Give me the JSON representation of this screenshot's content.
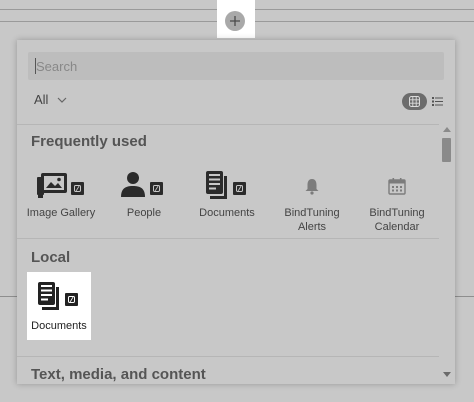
{
  "search": {
    "placeholder": "Search"
  },
  "filter": {
    "label": "All"
  },
  "sections": {
    "frequent": {
      "title": "Frequently used",
      "items": [
        {
          "label": "Image Gallery",
          "icon": "image-gallery-icon"
        },
        {
          "label": "People",
          "icon": "people-icon"
        },
        {
          "label": "Documents",
          "icon": "documents-icon"
        },
        {
          "label": "BindTuning Alerts",
          "icon": "bell-icon"
        },
        {
          "label": "BindTuning Calendar",
          "icon": "calendar-icon"
        }
      ]
    },
    "local": {
      "title": "Local",
      "items": [
        {
          "label": "Documents",
          "icon": "documents-icon"
        }
      ]
    },
    "text_media": {
      "title": "Text, media, and content"
    }
  },
  "colors": {
    "panel": "#c8c8c8",
    "highlight": "#ffffff",
    "icon_dark": "#2a2a2a"
  }
}
